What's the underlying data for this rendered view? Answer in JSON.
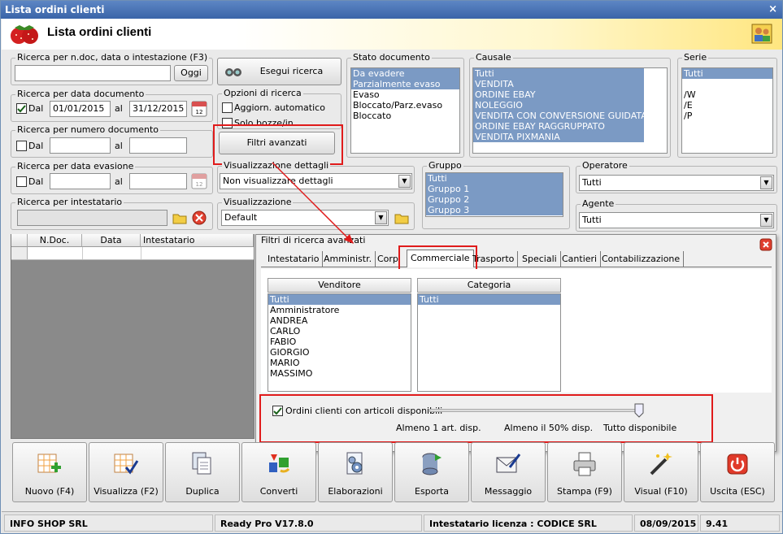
{
  "window": {
    "title": "Lista ordini clienti",
    "close": "×"
  },
  "header": {
    "title": "Lista ordini clienti"
  },
  "search_text": {
    "label": "Ricerca per n.doc, data o intestazione (F3)",
    "value": "",
    "button": "Oggi"
  },
  "search_btn": {
    "label": "Esegui ricerca"
  },
  "date_doc": {
    "label": "Ricerca per data documento",
    "dal_label": "Dal",
    "from": "01/01/2015",
    "al_label": "al",
    "to": "31/12/2015",
    "checked": true
  },
  "num_doc": {
    "label": "Ricerca per numero documento",
    "dal_label": "Dal",
    "from": "",
    "al_label": "al",
    "to": ""
  },
  "date_eva": {
    "label": "Ricerca per data evasione",
    "dal_label": "Dal",
    "from": "",
    "al_label": "al",
    "to": ""
  },
  "intestatario": {
    "label": "Ricerca per intestatario",
    "value": ""
  },
  "options": {
    "label": "Opzioni di ricerca",
    "items": [
      "Aggiorn. automatico",
      "Solo bozze/in preparaz."
    ]
  },
  "filters_btn": {
    "label": "Filtri avanzati"
  },
  "vis_dettagli": {
    "label": "Visualizzazione dettagli",
    "value": "Non visualizzare dettagli"
  },
  "visualizzazione": {
    "label": "Visualizzazione",
    "value": "Default"
  },
  "stato": {
    "label": "Stato documento",
    "items": [
      "Da evadere",
      "Parzialmente evaso",
      "Evaso",
      "Bloccato/Parz.evaso",
      "Bloccato"
    ],
    "selected": [
      0,
      1
    ]
  },
  "causale": {
    "label": "Causale",
    "items": [
      "Tutti",
      "VENDITA",
      "ORDINE EBAY",
      "NOLEGGIO",
      "VENDITA CON CONVERSIONE GUIDATA",
      "ORDINE EBAY RAGGRUPPATO",
      "VENDITA PIXMANIA"
    ],
    "selected": [
      0,
      1,
      2,
      3,
      4,
      5,
      6
    ]
  },
  "serie": {
    "label": "Serie",
    "items": [
      "Tutti",
      "",
      "/W",
      "/E",
      "/P"
    ],
    "selected": [
      0
    ]
  },
  "gruppo": {
    "label": "Gruppo",
    "items": [
      "Tutti",
      "Gruppo 1",
      "Gruppo 2",
      "Gruppo 3"
    ],
    "selected": [
      0,
      1,
      2,
      3
    ]
  },
  "operatore": {
    "label": "Operatore",
    "value": "Tutti"
  },
  "agente": {
    "label": "Agente",
    "value": "Tutti"
  },
  "grid": {
    "columns": [
      "N.Doc.",
      "Data",
      "Intestatario"
    ]
  },
  "panel": {
    "title": "Filtri di ricerca avanzati",
    "tabs": [
      "Intestatario",
      "Amministr.",
      "Corpo",
      "Commerciale",
      "Trasporto",
      "Speciali",
      "Cantieri",
      "Contabilizzazione"
    ],
    "active_tab": "Commerciale",
    "venditore": {
      "label": "Venditore",
      "items": [
        "Tutti",
        "Amministratore",
        "ANDREA",
        "CARLO",
        "FABIO",
        "GIORGIO",
        "MARIO",
        "MASSIMO"
      ]
    },
    "categoria": {
      "label": "Categoria",
      "items": [
        "Tutti"
      ]
    },
    "disp": {
      "label": "Ordini clienti con articoli disponibili",
      "checked": true,
      "scale": [
        "Almeno 1 art. disp.",
        "Almeno il 50% disp.",
        "Tutto disponibile"
      ],
      "level": 1.0
    }
  },
  "toolbar": [
    "Nuovo (F4)",
    "Visualizza (F2)",
    "Duplica",
    "Converti",
    "Elaborazioni",
    "Esporta",
    "Messaggio",
    "Stampa (F9)",
    "Visual (F10)",
    "Uscita (ESC)"
  ],
  "status": {
    "company": "INFO SHOP SRL",
    "version": "Ready Pro V17.8.0",
    "license": "Intestatario licenza : CODICE SRL",
    "date": "08/09/2015",
    "time": "9.41"
  },
  "colors": {
    "selection": "#7b9ac4",
    "highlight": "#e01b1b",
    "title": "#3a64a8"
  }
}
